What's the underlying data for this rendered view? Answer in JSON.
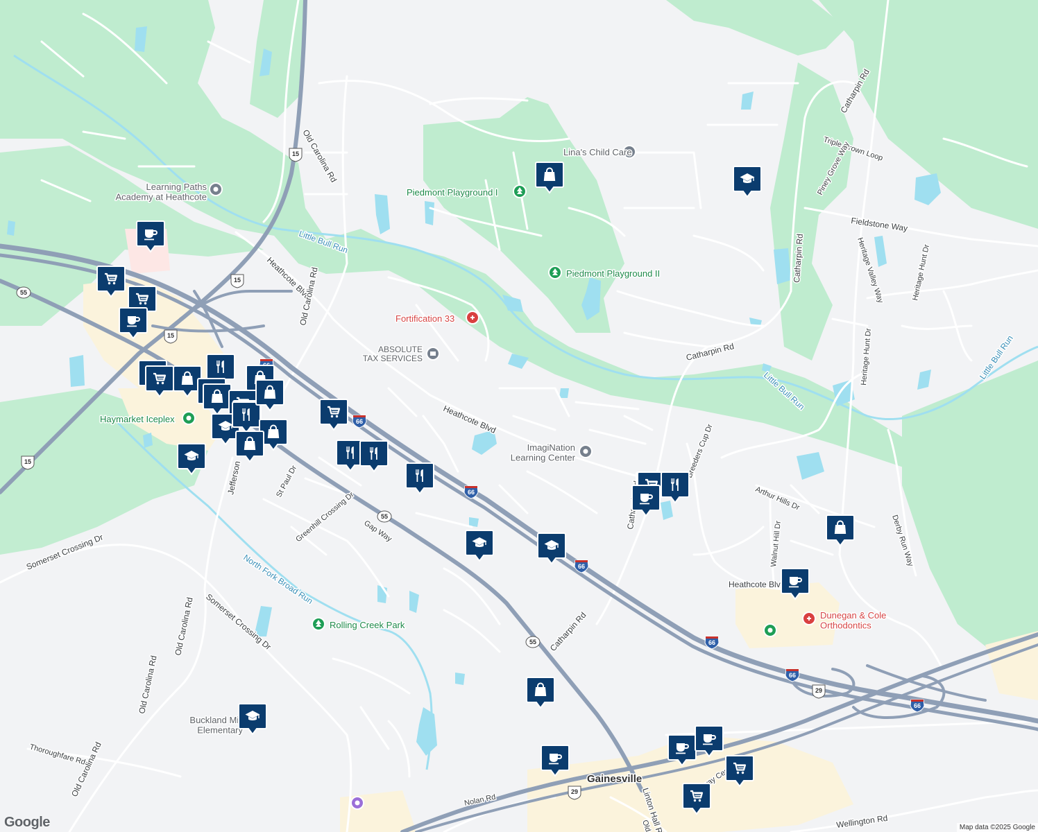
{
  "colors": {
    "background": "#f2f3f5",
    "park": "#bfeccf",
    "water": "#9fdff0",
    "commercial": "#fbf3dc",
    "highway": "#8f9fb6",
    "local_road": "#ffffff",
    "marker_fill": "#0b3c6e",
    "poi_park_icon": "#1e9e56",
    "poi_medical": "#d94040",
    "poi_gray": "#76808d"
  },
  "streets": [
    "Old Carolina Rd",
    "Heathcote Blvd",
    "Little Bull Run",
    "Old Carolina Rd",
    "Heathcote Blvd",
    "Catharpin Rd",
    "Catharpin Rd",
    "Catharpin Rd",
    "Triple Crown Loop",
    "Piney Grove Way",
    "Fieldstone Way",
    "Heritage Valley Way",
    "Heritage Hunt Dr",
    "Heritage Hunt Dr",
    "Little Bull Run",
    "Little Bull Run",
    "Breeders Cup Dr",
    "Arthur Hills Dr",
    "Walnut Hill Dr",
    "Derby Run Way",
    "Heathcote Blvd",
    "St Paul Dr",
    "Greenhill Crossing Dr",
    "Gap Way",
    "Jefferson",
    "Somerset Crossing Dr",
    "North Fork Broad Run",
    "Somerset Crossing Dr",
    "Old Carolina Rd",
    "Old Carolina Rd",
    "Thoroughfare Rd",
    "Old Carolina Rd",
    "Catharpin Rd",
    "Nolan Rd",
    "Linton Hall Rd",
    "Gateway Center",
    "Wellington Rd",
    "Catharpin Rd",
    "Old Li"
  ],
  "route_shields": [
    "15",
    "15",
    "15",
    "15",
    "55",
    "55",
    "55",
    "29",
    "29",
    "66",
    "66",
    "66",
    "66",
    "66",
    "66",
    "66"
  ],
  "places": [
    {
      "name": "Learning Paths\nAcademy at Heathcote",
      "type": "gray"
    },
    {
      "name": "Lina's Child Care",
      "type": "gray"
    },
    {
      "name": "Piedmont Playground I",
      "type": "park"
    },
    {
      "name": "Piedmont Playground II",
      "type": "park"
    },
    {
      "name": "Fortification 33",
      "type": "medical"
    },
    {
      "name": "ABSOLUTE\nTAX SERVICES",
      "type": "gray"
    },
    {
      "name": "ImagiNation\nLearning Center",
      "type": "gray"
    },
    {
      "name": "Haymarket Iceplex",
      "type": "park"
    },
    {
      "name": "Rolling Creek Park",
      "type": "park"
    },
    {
      "name": "Buckland Mill\nElementary",
      "type": "gray"
    },
    {
      "name": "Dunegan & Cole\nOrthodontics",
      "type": "medical"
    },
    {
      "name": "Gainesville",
      "type": "locality"
    }
  ],
  "markers": [
    "cup",
    "cart",
    "cart",
    "cup",
    "cart",
    "cart",
    "bag",
    "fork",
    "bag",
    "bag",
    "bag",
    "cart",
    "fork",
    "cap",
    "fork",
    "cap",
    "bag",
    "bag",
    "cart",
    "fork",
    "fork",
    "fork",
    "cap",
    "cap",
    "bag",
    "cap",
    "bag",
    "cart",
    "bag",
    "cup",
    "cart",
    "fork",
    "cup",
    "cap",
    "bag",
    "cup",
    "cup",
    "cup",
    "cart",
    "cart"
  ],
  "footer": {
    "logo": "Google",
    "attribution": "Map data ©2025 Google"
  }
}
